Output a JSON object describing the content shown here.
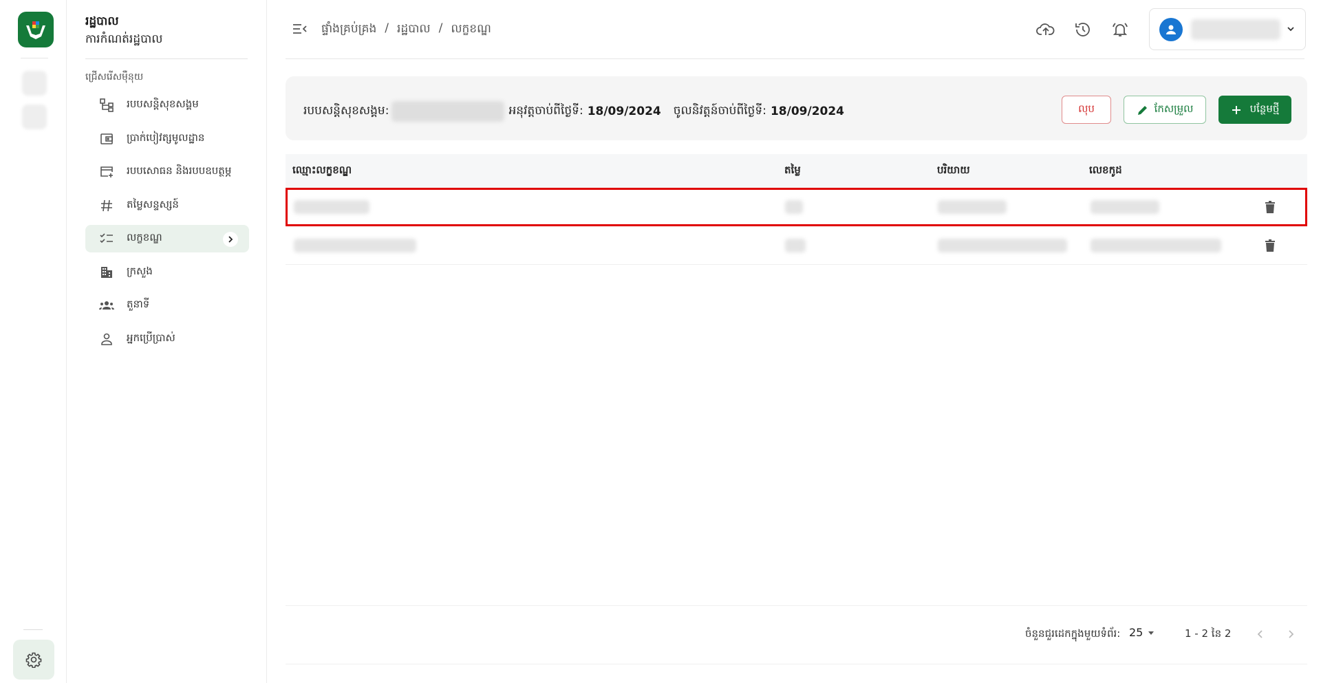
{
  "colors": {
    "brand": "#157a3a",
    "danger": "#d32f2f",
    "highlight": "#e00000",
    "avatar": "#1976d2"
  },
  "rail": {
    "logo_icon": "hands-heart-logo-icon",
    "settings_icon": "gear-icon"
  },
  "sidenav": {
    "title": "រដ្ឋបាល",
    "subtitle": "ការកំណត់រដ្ឋបាល",
    "section": "ជ្រើសរើសម៉ឺនុយ",
    "items": [
      {
        "label": "របបសន្តិសុខសង្គម",
        "icon": "hierarchy-icon",
        "active": false
      },
      {
        "label": "ប្រាក់បៀវត្សមូលដ្ឋាន",
        "icon": "wallet-icon",
        "active": false
      },
      {
        "label": "របបសោធន និងរបបឧបត្ថម្ភ",
        "icon": "card-plus-icon",
        "active": false
      },
      {
        "label": "តម្លៃសន្ទស្សន៍",
        "icon": "hash-icon",
        "active": false
      },
      {
        "label": "លក្ខខណ្ឌ",
        "icon": "checklist-icon",
        "active": true
      },
      {
        "label": "ក្រសួង",
        "icon": "building-icon",
        "active": false
      },
      {
        "label": "តួនាទី",
        "icon": "group-icon",
        "active": false
      },
      {
        "label": "អ្នកប្រើប្រាស់",
        "icon": "person-icon",
        "active": false
      }
    ]
  },
  "header": {
    "breadcrumb": [
      "ផ្ទាំងគ្រប់គ្រង",
      "/",
      "រដ្ឋបាល",
      "/",
      "លក្ខខណ្ឌ"
    ],
    "icons": [
      "cloud-upload-icon",
      "history-icon",
      "bell-icon"
    ]
  },
  "info": {
    "scheme_label": "របបសន្តិសុខសង្គម:",
    "applied_label": "អនុវត្តចាប់ពីថ្ងៃទី:",
    "applied_date": "18/09/2024",
    "effective_label": "ចូលនិវត្តន៍ចាប់ពីថ្ងៃទី:",
    "effective_date": "18/09/2024",
    "delete_label": "លុប",
    "edit_label": "កែសម្រួល",
    "add_label": "បន្ថែមថ្មី"
  },
  "table": {
    "headers": [
      "ឈ្មោះលក្ខខណ្ឌ",
      "តម្លៃ",
      "បរិយាយ",
      "លេខកូដ"
    ]
  },
  "pagination": {
    "rows_per_page_label": "ចំនួនជួរដេកក្នុងមួយទំព័រ:",
    "rows_per_page": "25",
    "range": "1 - 2 នៃ 2"
  }
}
